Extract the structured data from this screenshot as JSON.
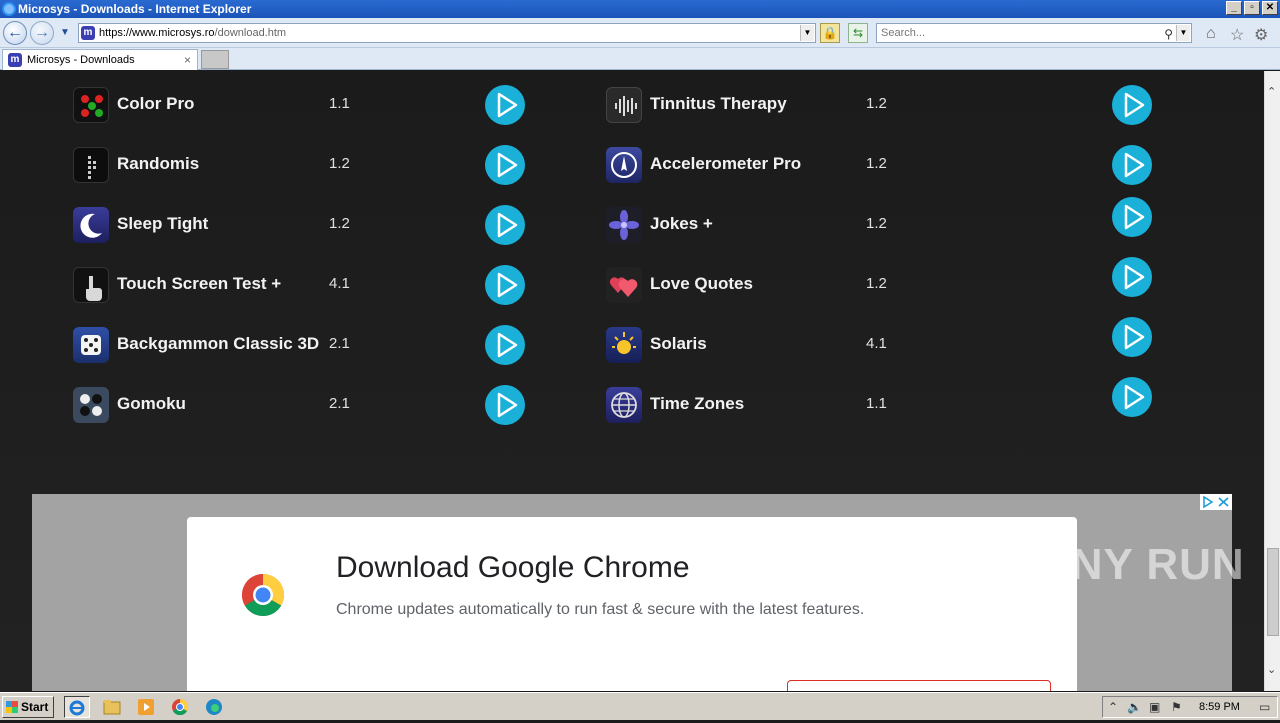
{
  "window": {
    "title": "Microsys - Downloads - Internet Explorer",
    "buttons": {
      "minimize": "_",
      "maximize": "▫",
      "close": "✕"
    }
  },
  "addressbar": {
    "url_host": "https://www.microsys.ro",
    "url_path": "/download.htm",
    "search_placeholder": "Search..."
  },
  "tab": {
    "label": "Microsys - Downloads",
    "close": "×"
  },
  "apps_left": [
    {
      "name": "Color Pro",
      "version": "1.1",
      "icon": "color-pro-icon"
    },
    {
      "name": "Randomis",
      "version": "1.2",
      "icon": "randomis-icon"
    },
    {
      "name": "Sleep Tight",
      "version": "1.2",
      "icon": "sleep-tight-icon"
    },
    {
      "name": "Touch Screen Test +",
      "version": "4.1",
      "icon": "touch-screen-icon"
    },
    {
      "name": "Backgammon Classic 3D",
      "version": "2.1",
      "icon": "dice-icon"
    },
    {
      "name": "Gomoku",
      "version": "2.1",
      "icon": "gomoku-icon"
    }
  ],
  "apps_right": [
    {
      "name": "Tinnitus Therapy",
      "version": "1.2",
      "icon": "waveform-icon"
    },
    {
      "name": "Accelerometer Pro",
      "version": "1.2",
      "icon": "compass-icon"
    },
    {
      "name": "Jokes +",
      "version": "1.2",
      "icon": "flower-icon"
    },
    {
      "name": "Love Quotes",
      "version": "1.2",
      "icon": "hearts-icon"
    },
    {
      "name": "Solaris",
      "version": "4.1",
      "icon": "sun-icon"
    },
    {
      "name": "Time Zones",
      "version": "1.1",
      "icon": "globe-icon"
    }
  ],
  "ad": {
    "title": "Download Google Chrome",
    "subtitle": "Chrome updates automatically to run fast & secure with the latest features."
  },
  "watermark": "ANY RUN",
  "taskbar": {
    "start": "Start",
    "time": "8:59 PM"
  },
  "colors": {
    "play_button": "#1ab0d8",
    "page_bg": "#1b1b1b",
    "ad_bg": "#a3a3a3"
  }
}
